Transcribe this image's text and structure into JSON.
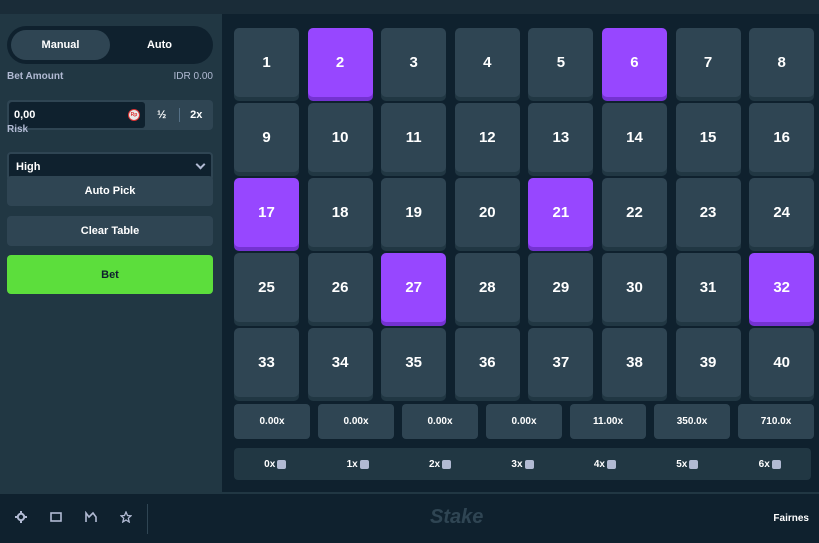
{
  "sidebar": {
    "modes": [
      "Manual",
      "Auto"
    ],
    "bet_amount_label": "Bet Amount",
    "balance": "IDR 0.00",
    "bet_value": "0,00",
    "currency_icon": "rupiah-coin-icon",
    "half_label": "½",
    "double_label": "2x",
    "risk_label": "Risk",
    "risk_value": "High",
    "auto_pick_label": "Auto Pick",
    "clear_table_label": "Clear Table",
    "bet_label": "Bet"
  },
  "board": {
    "tiles": [
      "1",
      "2",
      "3",
      "4",
      "5",
      "6",
      "7",
      "8",
      "9",
      "10",
      "11",
      "12",
      "13",
      "14",
      "15",
      "16",
      "17",
      "18",
      "19",
      "20",
      "21",
      "22",
      "23",
      "24",
      "25",
      "26",
      "27",
      "28",
      "29",
      "30",
      "31",
      "32",
      "33",
      "34",
      "35",
      "36",
      "37",
      "38",
      "39",
      "40"
    ],
    "selected": [
      "2",
      "6",
      "17",
      "21",
      "27",
      "32"
    ],
    "payouts": [
      "0.00x",
      "0.00x",
      "0.00x",
      "0.00x",
      "11.00x",
      "350.0x",
      "710.0x"
    ],
    "hits": [
      "0x",
      "1x",
      "2x",
      "3x",
      "4x",
      "5x",
      "6x"
    ]
  },
  "footer": {
    "icons": [
      "settings-icon",
      "theater-mode-icon",
      "stats-icon",
      "favorite-icon"
    ],
    "logo": "Stake",
    "fairness_label": "Fairnes"
  },
  "colors": {
    "selected_tile": "#9747ff",
    "tile": "#2f4553",
    "bet_button": "#5cde3c",
    "background": "#0f212e"
  }
}
